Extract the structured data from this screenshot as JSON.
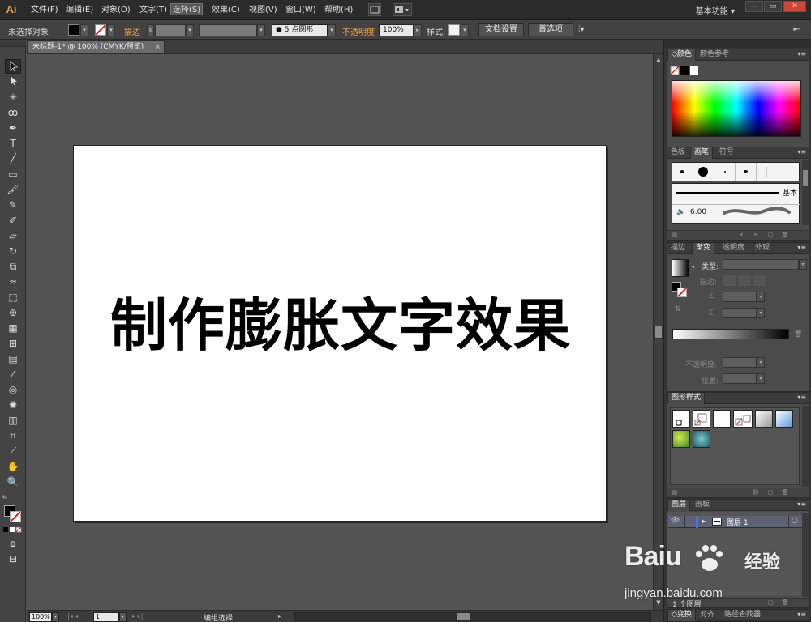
{
  "app": {
    "logo": "Ai",
    "menus": [
      "文件(F)",
      "编辑(E)",
      "对象(O)",
      "文字(T)",
      "选择(S)",
      "效果(C)",
      "视图(V)",
      "窗口(W)",
      "帮助(H)"
    ],
    "active_menu": "选择(S)",
    "workspace": "基本功能",
    "window_buttons": {
      "minimize": "—",
      "restore": "▭",
      "close": "✕"
    }
  },
  "control_bar": {
    "selection_status": "未选择对象",
    "stroke_label": "描边",
    "brush_point": "5 点圆形",
    "opacity_label": "不透明度",
    "opacity_value": "100%",
    "style_label": "样式",
    "doc_setup_button": "文档设置",
    "preferences_button": "首选项"
  },
  "document": {
    "tab_title": "未标题-1* @ 100% (CMYK/预览)",
    "headline": "制作膨胀文字效果"
  },
  "status_bar": {
    "zoom": "100%",
    "artboard_number": "1",
    "status_text": "编组选择"
  },
  "panels": {
    "color": {
      "tabs": [
        "颜色",
        "颜色参考"
      ]
    },
    "brushes": {
      "tabs": [
        "色板",
        "画笔",
        "符号"
      ],
      "basic_label": "基本",
      "size_value": "6.00"
    },
    "gradient": {
      "tabs": [
        "描边",
        "渐变",
        "透明度",
        "外观"
      ],
      "type_label": "类型:",
      "stroke_label": "描边:",
      "opacity_label": "不透明度:",
      "position_label": "位置:"
    },
    "graphic_styles": {
      "tabs": [
        "图形样式"
      ]
    },
    "layers": {
      "tabs": [
        "图层",
        "画板"
      ],
      "layer_name": "图层 1",
      "layer_count": "1 个图层"
    },
    "transform": {
      "tabs": [
        "变换",
        "对齐",
        "路径查找器"
      ]
    }
  },
  "watermark": {
    "brand": "Baiu",
    "suffix": "经验",
    "url": "jingyan.baidu.com"
  },
  "colors": {
    "accent_link": "#f0a245",
    "logo": "#f4a03d",
    "layer_highlight": "#5c6273"
  }
}
